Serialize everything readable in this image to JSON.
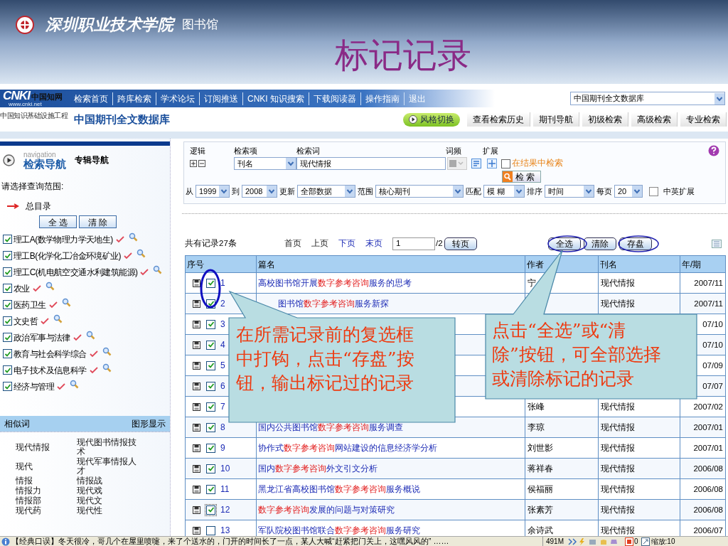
{
  "header": {
    "institution": "深圳职业技术学院",
    "library": "图书馆",
    "slide_title": "标记记录"
  },
  "top_nav": {
    "logo_mark": "CNKI",
    "logo_name": "中国知网",
    "logo_url": "www.cnki.net",
    "links": [
      "检索首页",
      "跨库检索",
      "学术论坛",
      "订阅推送",
      "CNKI 知识搜索",
      "下载阅读器",
      "操作指南",
      "退出"
    ],
    "database": "中国期刊全文数据库"
  },
  "subheader": {
    "tagline": "中国知识基础设施工程",
    "database_title": "中国期刊全文数据库",
    "style_button": "风格切换",
    "links": [
      "查看检索历史",
      "期刊导航",
      "初级检索",
      "高级检索",
      "专业检索"
    ]
  },
  "sidebar": {
    "nav_label": "navigation",
    "nav_title": "检索导航",
    "alt_title": "专辑导航",
    "scope_prompt": "请选择查询范围:",
    "root": "总目录",
    "buttons": [
      "全 选",
      "清 除"
    ],
    "categories": [
      {
        "label": "理工A(数学物理力学天地生)",
        "checked": true
      },
      {
        "label": "理工B(化学化工冶金环境矿业)",
        "checked": true
      },
      {
        "label": "理工C(机电航空交通水利建筑能源)",
        "checked": true
      },
      {
        "label": "农业",
        "checked": true
      },
      {
        "label": "医药卫生",
        "checked": true
      },
      {
        "label": "文史哲",
        "checked": true
      },
      {
        "label": "政治军事与法律",
        "checked": true
      },
      {
        "label": "教育与社会科学综合",
        "checked": true
      },
      {
        "label": "电子技术及信息科学",
        "checked": true
      },
      {
        "label": "经济与管理",
        "checked": true
      }
    ],
    "related_header": "相似词",
    "graph_link": "图形显示",
    "related_words": [
      [
        "现代情报",
        "现代图书情报技术"
      ],
      [
        "现代",
        "现代军事情报人才"
      ],
      [
        "情报",
        "情报战"
      ],
      [
        "情报力",
        "现代戏"
      ],
      [
        "情报部",
        "现代文"
      ],
      [
        "现代药",
        "现代性"
      ]
    ]
  },
  "search": {
    "headers": [
      "逻辑",
      "检索项",
      "检索词",
      "词频",
      "扩展"
    ],
    "field": "刊名",
    "term": "现代情报",
    "in_results": {
      "label": "在结果中检索",
      "checked": false
    },
    "search_button": "检 索",
    "filters": [
      {
        "label": "从",
        "value": "1999"
      },
      {
        "label": "到",
        "value": "2008"
      },
      {
        "label": "更新",
        "value": "全部数据"
      },
      {
        "label": "范围",
        "value": "核心期刊"
      },
      {
        "label": "匹配",
        "value": "模 糊"
      },
      {
        "label": "排序",
        "value": "时间"
      },
      {
        "label": "每页",
        "value": "20"
      }
    ],
    "cross_lang": {
      "label": "中英扩展",
      "checked": false
    }
  },
  "results": {
    "count_text": "共有记录27条",
    "pager": [
      {
        "label": "首页",
        "disabled": true
      },
      {
        "label": "上页",
        "disabled": true
      },
      {
        "label": "下页",
        "disabled": false
      },
      {
        "label": "末页",
        "disabled": false
      }
    ],
    "page": "1",
    "total": "/2",
    "go_button": "转页",
    "actions": [
      "全选",
      "清除",
      "存盘"
    ]
  },
  "table": {
    "columns": [
      "序号",
      "篇名",
      "作者",
      "刊名",
      "年/期"
    ],
    "rows": [
      {
        "no": "1",
        "checked": true,
        "title": [
          {
            "text": "高校图书馆开展",
            "highlight": false
          },
          {
            "text": "数字参考咨询",
            "highlight": true
          },
          {
            "text": "服务的思考",
            "highlight": false
          }
        ],
        "author": "宁",
        "journal": "现代情报",
        "issue": "2007/11"
      },
      {
        "no": "2",
        "checked": true,
        "title": [
          {
            "text": "图书馆",
            "highlight": false
          },
          {
            "text": "数字参考咨询",
            "highlight": true
          },
          {
            "text": "服务新探",
            "highlight": false
          }
        ],
        "journal": "现代情报",
        "issue": "2007/11"
      },
      {
        "no": "3",
        "checked": true,
        "issue": "07/10"
      },
      {
        "no": "4",
        "checked": true,
        "issue": "07/10"
      },
      {
        "no": "5",
        "checked": true,
        "issue": "07/09"
      },
      {
        "no": "6",
        "checked": true,
        "issue": "07/07"
      },
      {
        "no": "7",
        "checked": true,
        "author": "张峰",
        "journal": "现代情报",
        "issue": "2007/02"
      },
      {
        "no": "8",
        "checked": true,
        "title": [
          {
            "text": "国内公共图书馆",
            "highlight": false
          },
          {
            "text": "数字参考咨询",
            "highlight": true
          },
          {
            "text": "服务调查",
            "highlight": false
          }
        ],
        "author": "李琼",
        "journal": "现代情报",
        "issue": "2007/01"
      },
      {
        "no": "9",
        "checked": true,
        "title": [
          {
            "text": "协作式",
            "highlight": false
          },
          {
            "text": "数字参考咨询",
            "highlight": true
          },
          {
            "text": "网站建设的信息经济学分析",
            "highlight": false
          }
        ],
        "author": "刘世影",
        "journal": "现代情报",
        "issue": "2007/01"
      },
      {
        "no": "10",
        "checked": true,
        "title": [
          {
            "text": "国内",
            "highlight": false
          },
          {
            "text": "数字参考咨询",
            "highlight": true
          },
          {
            "text": "外文引文分析",
            "highlight": false
          }
        ],
        "author": "蒋祥春",
        "journal": "现代情报",
        "issue": "2006/08"
      },
      {
        "no": "11",
        "checked": true,
        "title": [
          {
            "text": "黑龙江省高校图书馆",
            "highlight": false
          },
          {
            "text": "数字参考咨询",
            "highlight": true
          },
          {
            "text": "服务概说",
            "highlight": false
          }
        ],
        "author": "侯福丽",
        "journal": "现代情报",
        "issue": "2006/08"
      },
      {
        "no": "12",
        "checked": true,
        "title": [
          {
            "text": "数字参考咨询",
            "highlight": true
          },
          {
            "text": "发展的问题与对策研究",
            "highlight": false
          }
        ],
        "author": "张素芳",
        "journal": "现代情报",
        "issue": "2006/08"
      },
      {
        "no": "13",
        "checked": false,
        "title": [
          {
            "text": "军队院校图书馆联合",
            "highlight": false
          },
          {
            "text": "数字参考咨询",
            "highlight": true
          },
          {
            "text": "服务研究",
            "highlight": false
          }
        ],
        "author": "余诗武",
        "journal": "现代情报",
        "issue": "2006/07"
      }
    ]
  },
  "callouts": [
    {
      "text": "在所需记录前的复选框中打钩，点击“存盘”按钮，输出标记过的记录"
    },
    {
      "text": "点击“全选”或“清除”按钮，可全部选择或清除标记的记录"
    }
  ],
  "status_bar": {
    "ticker": "【经典口误】冬天很冷，哥几个在屋里喷嚏，来了个送水的，门开的时间长了一点，某人大喊“赶紧把门关上，这嘿风风的” ……",
    "memory": "491M",
    "count": "0",
    "zoom": "缩放:10"
  }
}
